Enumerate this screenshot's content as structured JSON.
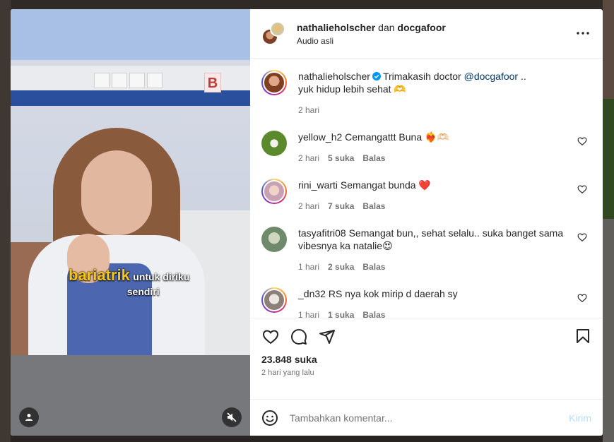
{
  "post": {
    "header": {
      "user_primary": "nathalieholscher",
      "joiner": "dan",
      "user_secondary": "docgafoor",
      "audio": "Audio asli"
    },
    "caption": {
      "username": "nathalieholscher",
      "text_before": "Trimakasih doctor",
      "mention": "@docgafoor",
      "text_after": "..",
      "line2": "yuk hidup lebih sehat 🫶",
      "time": "2 hari"
    },
    "comments": [
      {
        "username": "yellow_h2",
        "text": "Cemangattt Buna ❤️‍🔥🫶🏻",
        "time": "2 hari",
        "likes": "5 suka",
        "reply": "Balas",
        "avatar_color": "#5a8a2c"
      },
      {
        "username": "rini_warti",
        "text": "Semangat bunda ❤️",
        "time": "2 hari",
        "likes": "7 suka",
        "reply": "Balas",
        "avatar_color": "#d9b3c2"
      },
      {
        "username": "tasyafitri08",
        "text": "Semangat bun,, sehat selalu.. suka banget sama vibesnya ka natalie😍",
        "time": "1 hari",
        "likes": "2 suka",
        "reply": "Balas",
        "avatar_color": "#6f8a6a"
      },
      {
        "username": "_dn32",
        "text": "RS nya kok mirip d daerah sy",
        "time": "1 hari",
        "likes": "1 suka",
        "reply": "Balas",
        "avatar_color": "#b2a6a0"
      }
    ],
    "likes_count": "23.848 suka",
    "posted": "2 hari yang lalu",
    "comment_input": {
      "placeholder": "Tambahkan komentar...",
      "submit": "Kirim"
    },
    "video_overlay": {
      "highlight": "bariatrik",
      "rest": "untuk diriku",
      "line2": "sendiri"
    },
    "sign_letter": "B"
  }
}
